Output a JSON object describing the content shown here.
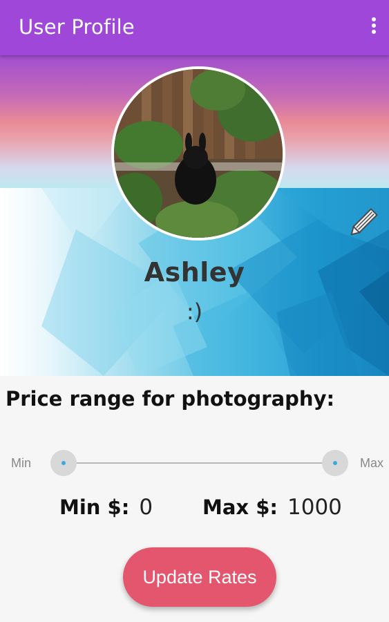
{
  "appbar": {
    "title": "User Profile",
    "menu_icon": "more-vert-icon"
  },
  "profile": {
    "name": "Ashley",
    "status": ":)",
    "edit_icon": "pencil-icon"
  },
  "pricing": {
    "title": "Price range for photography:",
    "range": {
      "min_label": "Min",
      "max_label": "Max",
      "min_value": 0,
      "max_value": 1000,
      "low_position": 0,
      "high_position": 1
    },
    "min_label": "Min $:",
    "min_value": "0",
    "max_label": "Max $:",
    "max_value": "1000"
  },
  "actions": {
    "update_label": "Update Rates"
  },
  "colors": {
    "appbar": "#9e47d8",
    "button": "#e4566d",
    "slider_accent": "#3aa9e0"
  }
}
